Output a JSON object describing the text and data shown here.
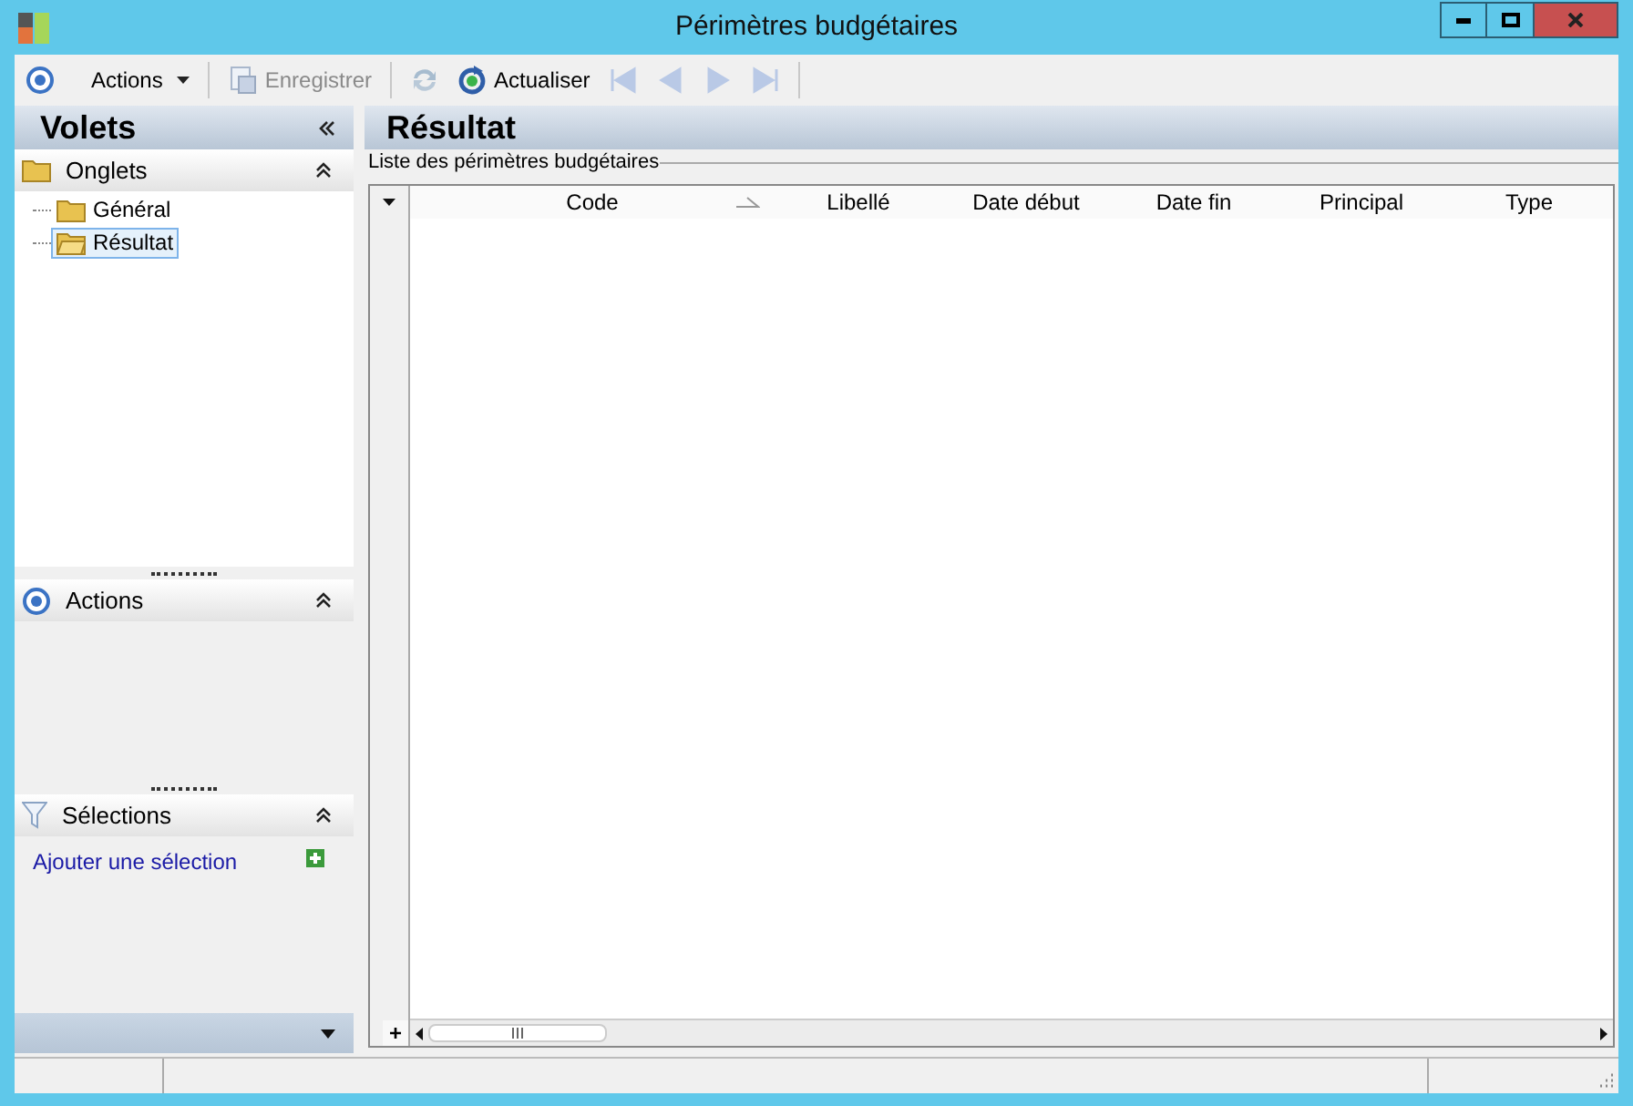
{
  "window": {
    "title": "Périmètres budgétaires"
  },
  "toolbar": [
    {
      "kind": "menu",
      "label": "Actions",
      "disabled": false
    },
    {
      "kind": "separator"
    },
    {
      "kind": "save",
      "label": "Enregistrer",
      "disabled": true
    },
    {
      "kind": "separator"
    },
    {
      "kind": "sync",
      "disabled": true
    },
    {
      "kind": "refresh",
      "label": "Actualiser",
      "disabled": false
    },
    {
      "kind": "first",
      "disabled": true
    },
    {
      "kind": "prev",
      "disabled": true
    },
    {
      "kind": "next",
      "disabled": true
    },
    {
      "kind": "last",
      "disabled": true
    },
    {
      "kind": "separator"
    }
  ],
  "sidebar": {
    "title": "Volets",
    "sections": [
      {
        "kind": "tabs",
        "title": "Onglets",
        "expanded": true,
        "items": [
          {
            "label": "Général",
            "selected": false
          },
          {
            "label": "Résultat",
            "selected": true
          }
        ]
      },
      {
        "kind": "actions",
        "title": "Actions",
        "expanded": true
      },
      {
        "kind": "selections",
        "title": "Sélections",
        "expanded": true,
        "link": "Ajouter une sélection"
      }
    ]
  },
  "content": {
    "title": "Résultat",
    "group_title": "Liste des périmètres budgétaires",
    "columns": [
      {
        "label": "Code",
        "sorted": true
      },
      {
        "label": "Libellé",
        "sorted": false
      },
      {
        "label": "Date début",
        "sorted": false
      },
      {
        "label": "Date fin",
        "sorted": false
      },
      {
        "label": "Principal",
        "sorted": false
      },
      {
        "label": "Type",
        "sorted": false
      }
    ],
    "add_row_symbol": "+"
  }
}
